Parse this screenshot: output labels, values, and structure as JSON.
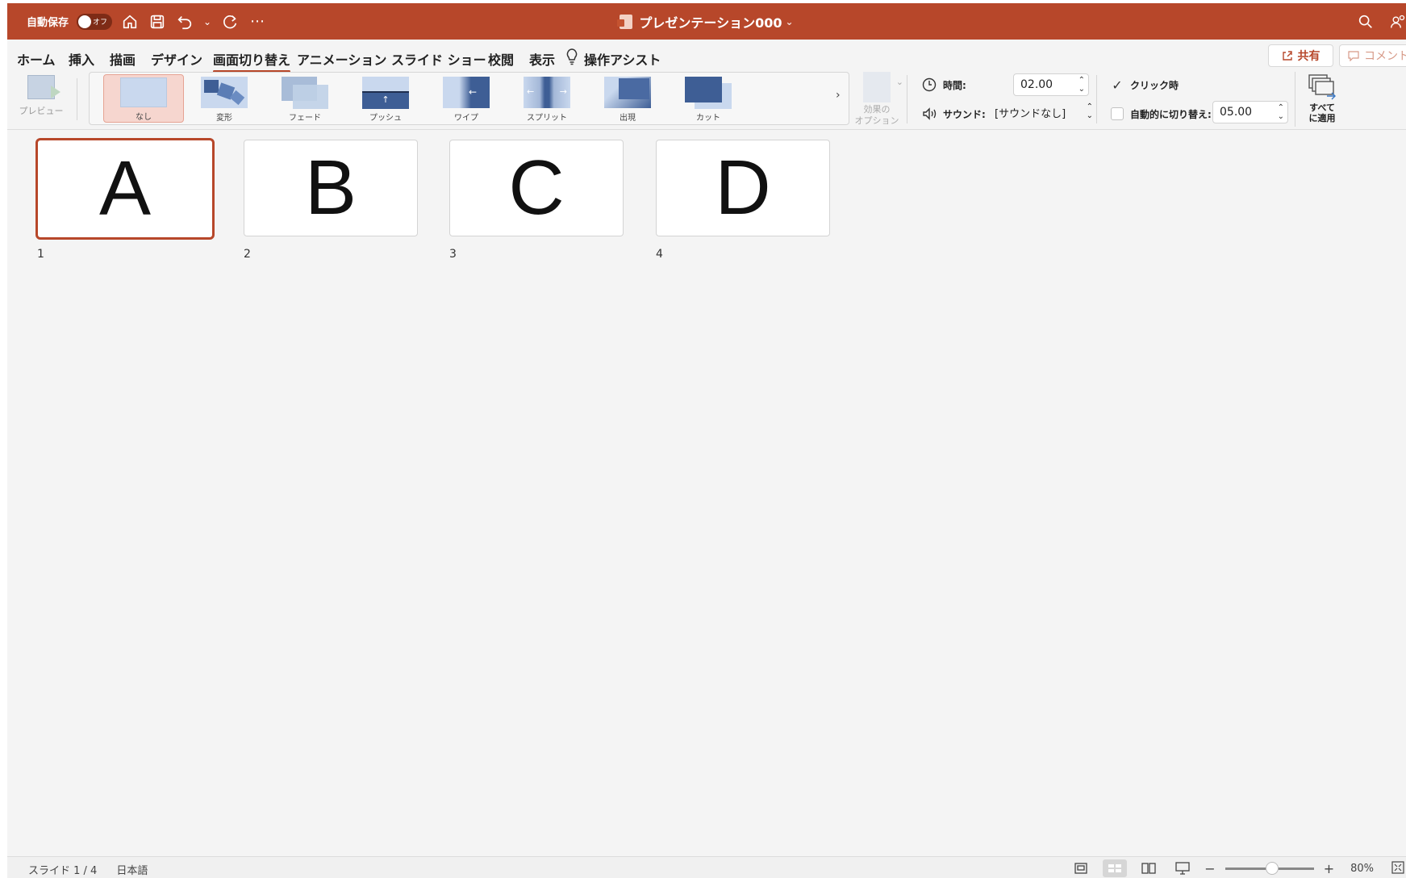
{
  "titlebar": {
    "autosave_label": "自動保存",
    "autosave_state": "オフ",
    "doc_title": "プレゼンテーション000",
    "title_chevron": "⌄",
    "more_label": "⋯",
    "accent_color": "#b7472a"
  },
  "tabs": [
    {
      "label": "ホーム"
    },
    {
      "label": "挿入"
    },
    {
      "label": "描画"
    },
    {
      "label": "デザイン"
    },
    {
      "label": "画面切り替え",
      "active": true
    },
    {
      "label": "アニメーション"
    },
    {
      "label": "スライド ショー"
    },
    {
      "label": "校閲"
    },
    {
      "label": "表示"
    },
    {
      "label": "操作アシスト"
    }
  ],
  "share_label": "共有",
  "comment_label": "コメント",
  "ribbon": {
    "preview_label": "プレビュー",
    "transitions": [
      {
        "label": "なし",
        "selected": true
      },
      {
        "label": "変形"
      },
      {
        "label": "フェード"
      },
      {
        "label": "プッシュ"
      },
      {
        "label": "ワイプ"
      },
      {
        "label": "スプリット"
      },
      {
        "label": "出現"
      },
      {
        "label": "カット"
      }
    ],
    "gallery_next": "›",
    "effect_options_line1": "効果の",
    "effect_options_line2": "オプション",
    "duration_label": "時間:",
    "duration_value": "02.00",
    "sound_label": "サウンド:",
    "sound_value": "[サウンドなし]",
    "on_click_label": "クリック時",
    "on_click_checked": true,
    "auto_advance_label": "自動的に切り替え:",
    "auto_advance_checked": false,
    "auto_advance_value": "05.00",
    "apply_all_line1": "すべて",
    "apply_all_line2": "に適用",
    "spin_arrows": "⌃⌄"
  },
  "slides": [
    {
      "number": "1",
      "text": "A",
      "selected": true
    },
    {
      "number": "2",
      "text": "B"
    },
    {
      "number": "3",
      "text": "C"
    },
    {
      "number": "4",
      "text": "D"
    }
  ],
  "statusbar": {
    "slide_info": "スライド 1 / 4",
    "language": "日本語",
    "zoom_minus": "−",
    "zoom_plus": "+",
    "zoom_value": "80%"
  }
}
